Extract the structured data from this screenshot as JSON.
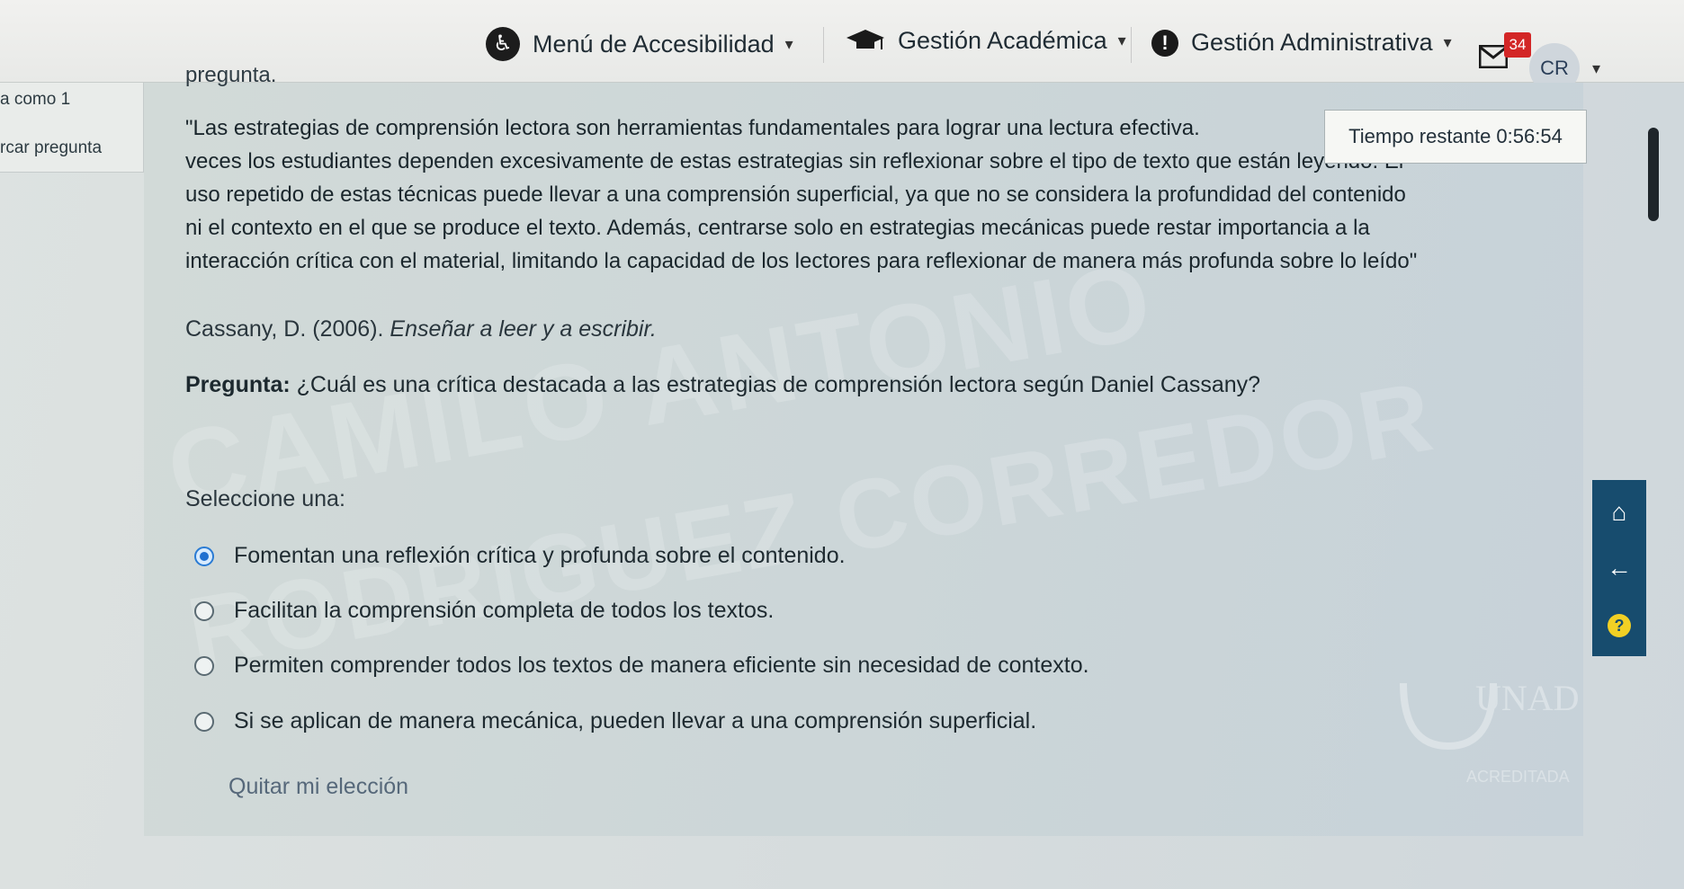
{
  "nav": {
    "accessibility": "Menú de Accesibilidad",
    "academic": "Gestión Académica",
    "administrative": "Gestión Administrativa",
    "badge": "34",
    "avatar": "CR"
  },
  "sidebar": {
    "row1": "a como 1",
    "row2": "rcar pregunta"
  },
  "timer": "Tiempo restante 0:56:54",
  "question": {
    "fragment_top": "pregunta.",
    "quote_lines": [
      "\"Las estrategias de comprensión lectora son herramientas fundamentales para lograr una lectura efectiva.",
      "veces los estudiantes dependen excesivamente de estas estrategias sin reflexionar sobre el tipo de texto que están leyendo. El",
      "uso repetido de estas técnicas puede llevar a una comprensión superficial, ya que no se considera la profundidad del contenido",
      "ni el contexto en el que se produce el texto. Además, centrarse solo en estrategias mecánicas puede restar importancia a la",
      "interacción crítica con el material, limitando la capacidad de los lectores para reflexionar de manera más profunda sobre lo leído\""
    ],
    "source_author": "Cassany, D. (2006). ",
    "source_title": "Enseñar a leer y a escribir.",
    "prompt_label": "Pregunta:",
    "prompt_text": " ¿Cuál es una crítica destacada a las estrategias de comprensión lectora según Daniel Cassany?",
    "select_label": "Seleccione una:",
    "options": [
      "Fomentan una reflexión crítica y profunda sobre el contenido.",
      "Facilitan la comprensión completa de todos los textos.",
      "Permiten comprender todos los textos de manera eficiente sin necesidad de contexto.",
      "Si se aplican de manera mecánica, pueden llevar a una comprensión superficial."
    ],
    "selected_index": 0,
    "clear_label": "Quitar mi elección"
  },
  "watermark": {
    "line1": "CAMILO ANTONIO",
    "line2": "RODRIGUEZ CORREDOR"
  },
  "logo": {
    "name": "UNAD",
    "tagline": "ACREDITADA"
  },
  "icons": {
    "accessibility": "accessibility-icon",
    "academic": "graduation-cap-icon",
    "administrative": "warning-icon",
    "mail": "mail-icon",
    "home": "home-icon",
    "back": "arrow-left-icon",
    "help": "help-icon"
  }
}
